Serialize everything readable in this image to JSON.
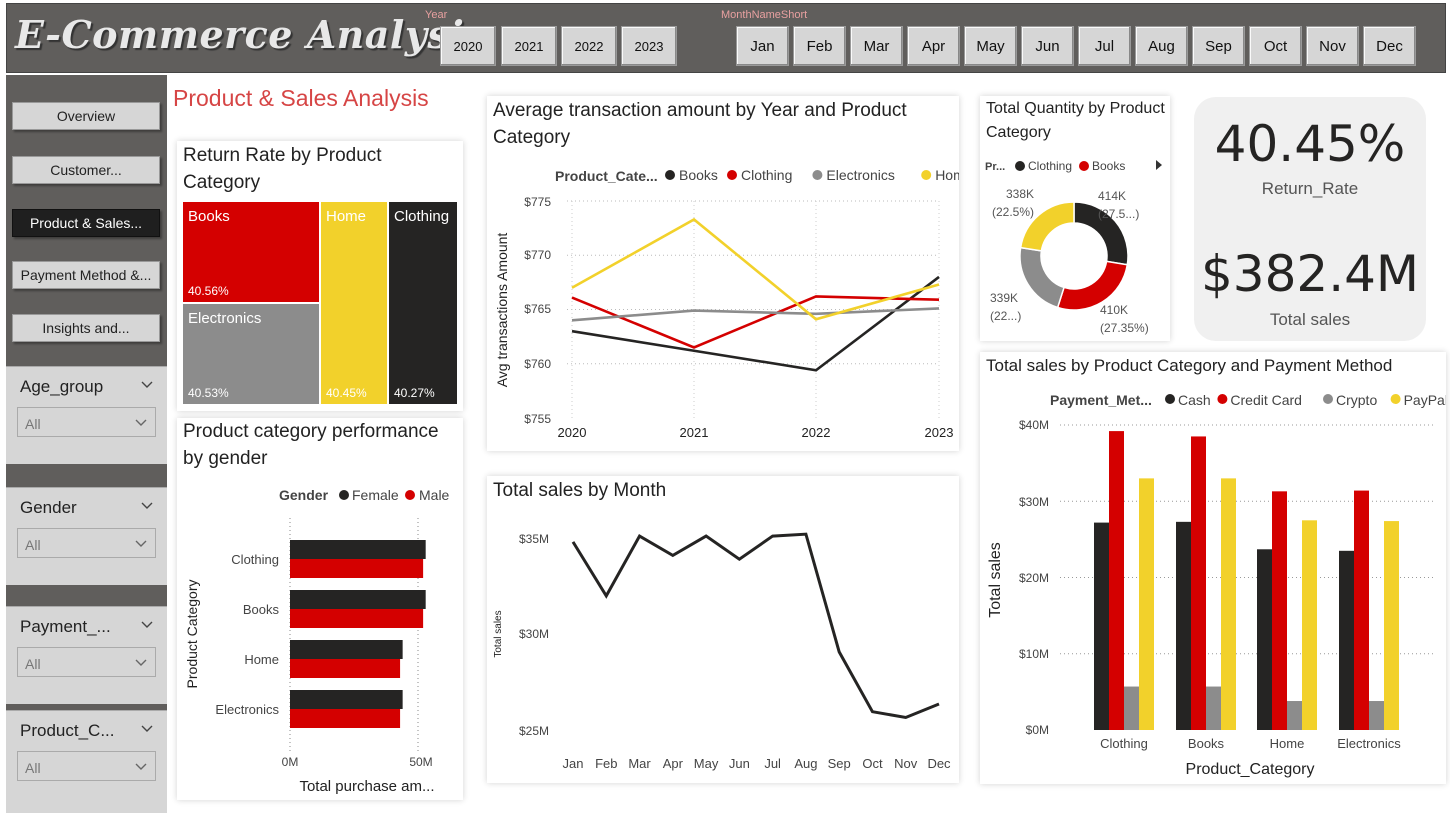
{
  "header": {
    "title": "E-Commerce Analysis",
    "year_label": "Year",
    "month_label": "MonthNameShort",
    "years": [
      "2020",
      "2021",
      "2022",
      "2023"
    ],
    "months": [
      "Jan",
      "Feb",
      "Mar",
      "Apr",
      "May",
      "Jun",
      "Jul",
      "Aug",
      "Sep",
      "Oct",
      "Nov",
      "Dec"
    ]
  },
  "nav": {
    "items": [
      "Overview",
      "Customer...",
      "Product & Sales...",
      "Payment Method &...",
      "Insights and..."
    ],
    "active_index": 2
  },
  "filters": [
    {
      "label": "Age_group",
      "value": "All"
    },
    {
      "label": "Gender",
      "value": "All"
    },
    {
      "label": "Payment_...",
      "value": "All"
    },
    {
      "label": "Product_C...",
      "value": "All"
    }
  ],
  "page_title": "Product & Sales Analysis",
  "colors": {
    "books": "#252423",
    "clothing": "#d40000",
    "electronics": "#8c8c8c",
    "home": "#f2d12b",
    "cash": "#252423",
    "credit_card": "#d40000",
    "crypto": "#8c8c8c",
    "paypal": "#f2d12b"
  },
  "treemap": {
    "title": "Return Rate by Product Category",
    "cells": [
      {
        "name": "Books",
        "value": "40.56%",
        "color": "#d40000"
      },
      {
        "name": "Electronics",
        "value": "40.53%",
        "color": "#8c8c8c"
      },
      {
        "name": "Home",
        "value": "40.45%",
        "color": "#f2d12b"
      },
      {
        "name": "Clothing",
        "value": "40.27%",
        "color": "#252423"
      }
    ]
  },
  "gender_chart": {
    "title": "Product category performance by gender",
    "legend_title": "Gender",
    "legend": [
      "Female",
      "Male"
    ],
    "ylabel": "Product Category",
    "xlabel": "Total purchase am...",
    "ticks": [
      "0M",
      "50M"
    ]
  },
  "avg_chart": {
    "title": "Average transaction amount by Year and Product Category",
    "legend_title": "Product_Cate...",
    "ylabel": "Avg transactions Amount",
    "ticks": [
      "$775",
      "$770",
      "$765",
      "$760",
      "$755"
    ]
  },
  "month_chart": {
    "title": "Total sales by Month",
    "ylabel": "Total sales",
    "ticks": [
      "$35M",
      "$30M",
      "$25M"
    ]
  },
  "donut": {
    "title": "Total Quantity by Product Category",
    "legend_title": "Pr...",
    "legend": [
      "Clothing",
      "Books"
    ],
    "labels": [
      {
        "value": "414K",
        "pct": "(27.5...)"
      },
      {
        "value": "410K",
        "pct": "(27.35%)"
      },
      {
        "value": "339K",
        "pct": "(22...)"
      },
      {
        "value": "338K",
        "pct": "(22.5%)"
      }
    ]
  },
  "kpi": {
    "return_rate": "40.45%",
    "return_rate_label": "Return_Rate",
    "total_sales": "$382.4M",
    "total_sales_label": "Total sales"
  },
  "payment_chart": {
    "title": "Total sales by Product Category and Payment Method",
    "legend_title": "Payment_Met...",
    "xlabel": "Product_Category",
    "ylabel": "Total sales",
    "ticks": [
      "$40M",
      "$30M",
      "$20M",
      "$10M",
      "$0M"
    ]
  },
  "chart_data": [
    {
      "type": "treemap",
      "title": "Return Rate by Product Category",
      "categories": [
        "Books",
        "Electronics",
        "Home",
        "Clothing"
      ],
      "values": [
        40.56,
        40.53,
        40.45,
        40.27
      ]
    },
    {
      "type": "bar",
      "orientation": "horizontal",
      "title": "Product category performance by gender",
      "categories": [
        "Clothing",
        "Books",
        "Home",
        "Electronics"
      ],
      "series": [
        {
          "name": "Female",
          "values": [
            53,
            53,
            44,
            44
          ]
        },
        {
          "name": "Male",
          "values": [
            52,
            52,
            43,
            43
          ]
        }
      ],
      "xlabel": "Total purchase am...",
      "ylabel": "Product Category",
      "xlim": [
        0,
        55
      ],
      "unit": "M"
    },
    {
      "type": "line",
      "title": "Average transaction amount by Year and Product Category",
      "x": [
        "2020",
        "2021",
        "2022",
        "2023"
      ],
      "series": [
        {
          "name": "Books",
          "values": [
            763.0,
            761.2,
            759.4,
            768.0
          ]
        },
        {
          "name": "Clothing",
          "values": [
            766.1,
            761.5,
            766.2,
            765.9
          ]
        },
        {
          "name": "Electronics",
          "values": [
            764.0,
            764.9,
            764.6,
            765.1
          ]
        },
        {
          "name": "Home",
          "values": [
            767.0,
            773.3,
            764.1,
            767.3
          ]
        }
      ],
      "ylabel": "Avg transactions Amount",
      "ylim": [
        755,
        775
      ]
    },
    {
      "type": "line",
      "title": "Total sales by Month",
      "x": [
        "Jan",
        "Feb",
        "Mar",
        "Apr",
        "May",
        "Jun",
        "Jul",
        "Aug",
        "Sep",
        "Oct",
        "Nov",
        "Dec"
      ],
      "series": [
        {
          "name": "Total sales",
          "values": [
            34.8,
            32.0,
            35.1,
            34.1,
            35.1,
            33.9,
            35.1,
            35.2,
            29.1,
            26.0,
            25.7,
            26.4
          ]
        }
      ],
      "ylabel": "Total sales",
      "ylim": [
        24.5,
        36.0
      ],
      "unit": "M"
    },
    {
      "type": "pie",
      "title": "Total Quantity by Product Category",
      "categories": [
        "Books",
        "Clothing",
        "Electronics",
        "Home"
      ],
      "values": [
        414,
        410,
        339,
        338
      ],
      "unit": "K"
    },
    {
      "type": "bar",
      "title": "Total sales by Product Category and Payment Method",
      "categories": [
        "Clothing",
        "Books",
        "Home",
        "Electronics"
      ],
      "series": [
        {
          "name": "Cash",
          "values": [
            27.2,
            27.3,
            23.7,
            23.5
          ]
        },
        {
          "name": "Credit Card",
          "values": [
            39.2,
            38.5,
            31.3,
            31.4
          ]
        },
        {
          "name": "Crypto",
          "values": [
            5.7,
            5.7,
            3.8,
            3.8
          ]
        },
        {
          "name": "PayPal",
          "values": [
            33.0,
            33.0,
            27.5,
            27.4
          ]
        }
      ],
      "xlabel": "Product_Category",
      "ylabel": "Total sales",
      "ylim": [
        0,
        40
      ],
      "unit": "M"
    }
  ]
}
